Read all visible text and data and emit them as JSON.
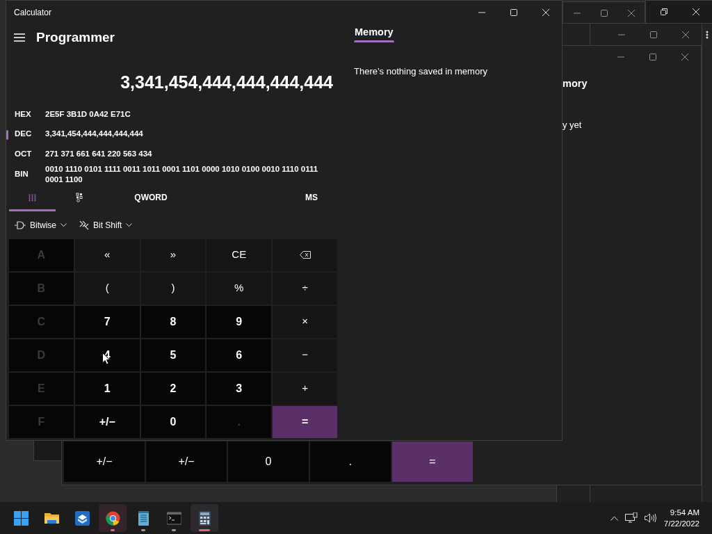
{
  "window": {
    "title": "Calculator"
  },
  "mode": "Programmer",
  "display": "3,341,454,444,444,444,444",
  "radix": [
    {
      "label": "HEX",
      "value": "2E5F 3B1D 0A42 E71C",
      "selected": false
    },
    {
      "label": "DEC",
      "value": "3,341,454,444,444,444,444",
      "selected": true
    },
    {
      "label": "OCT",
      "value": "271 371 661 641 220 563 434",
      "selected": false
    },
    {
      "label": "BIN",
      "value": "0010 1110 0101 1111 0011 1011 0001 1101 0000 1010 0100 0010 1110 0111 0001 1100",
      "selected": false
    }
  ],
  "tabs": [
    {
      "kind": "keypad",
      "selected": true
    },
    {
      "kind": "bits",
      "selected": false
    },
    {
      "kind": "text",
      "label": "QWORD",
      "selected": false
    },
    {
      "kind": "text",
      "label": "MS",
      "selected": false
    }
  ],
  "menus": [
    {
      "kind": "bitwise",
      "label": "Bitwise"
    },
    {
      "kind": "bitshift",
      "label": "Bit Shift"
    }
  ],
  "keys": [
    {
      "label": "A",
      "kind": "digit",
      "disabled": true
    },
    {
      "label": "«",
      "kind": "op",
      "disabled": false
    },
    {
      "label": "»",
      "kind": "op",
      "disabled": false
    },
    {
      "label": "CE",
      "kind": "op",
      "disabled": false
    },
    {
      "kind": "backspace",
      "disabled": false
    },
    {
      "label": "B",
      "kind": "digit",
      "disabled": true
    },
    {
      "label": "(",
      "kind": "op",
      "disabled": false
    },
    {
      "label": ")",
      "kind": "op",
      "disabled": false
    },
    {
      "label": "%",
      "kind": "op",
      "disabled": false
    },
    {
      "label": "÷",
      "kind": "op",
      "disabled": false
    },
    {
      "label": "C",
      "kind": "digit",
      "disabled": true
    },
    {
      "label": "7",
      "kind": "digit",
      "disabled": false
    },
    {
      "label": "8",
      "kind": "digit",
      "disabled": false
    },
    {
      "label": "9",
      "kind": "digit",
      "disabled": false
    },
    {
      "label": "×",
      "kind": "op",
      "disabled": false
    },
    {
      "label": "D",
      "kind": "digit",
      "disabled": true
    },
    {
      "label": "4",
      "kind": "digit",
      "disabled": false
    },
    {
      "label": "5",
      "kind": "digit",
      "disabled": false
    },
    {
      "label": "6",
      "kind": "digit",
      "disabled": false
    },
    {
      "label": "−",
      "kind": "op",
      "disabled": false
    },
    {
      "label": "E",
      "kind": "digit",
      "disabled": true
    },
    {
      "label": "1",
      "kind": "digit",
      "disabled": false
    },
    {
      "label": "2",
      "kind": "digit",
      "disabled": false
    },
    {
      "label": "3",
      "kind": "digit",
      "disabled": false
    },
    {
      "label": "+",
      "kind": "op",
      "disabled": false
    },
    {
      "label": "F",
      "kind": "digit",
      "disabled": true
    },
    {
      "label": "+/−",
      "kind": "digit",
      "disabled": false
    },
    {
      "label": "0",
      "kind": "digit",
      "disabled": false
    },
    {
      "label": ".",
      "kind": "digit",
      "disabled": true
    },
    {
      "label": "=",
      "kind": "equals",
      "disabled": false
    }
  ],
  "memory": {
    "tab": "Memory",
    "message": "There’s nothing saved in memory"
  },
  "background_window": {
    "heading": "mory",
    "message": "y yet",
    "keys": [
      {
        "label": "+/−",
        "kind": "digit"
      },
      {
        "label": "+/−",
        "kind": "digit"
      },
      {
        "label": "0",
        "kind": "digit"
      },
      {
        "label": ".",
        "kind": "digit"
      },
      {
        "label": "=",
        "kind": "equals"
      }
    ]
  },
  "taskbar": {
    "apps": [
      {
        "kind": "start",
        "running": false,
        "flashing": false,
        "selected": false
      },
      {
        "kind": "folder",
        "running": false,
        "flashing": false,
        "selected": false
      },
      {
        "kind": "box",
        "running": false,
        "flashing": false,
        "selected": false
      },
      {
        "kind": "browser",
        "running": true,
        "flashing": true,
        "selected": false
      },
      {
        "kind": "notepad",
        "running": true,
        "flashing": false,
        "selected": false
      },
      {
        "kind": "terminal",
        "running": true,
        "flashing": false,
        "selected": false
      },
      {
        "kind": "calculator",
        "running": true,
        "flashing": false,
        "selected": true
      }
    ],
    "time": "9:54 AM",
    "date": "7/22/2022"
  }
}
